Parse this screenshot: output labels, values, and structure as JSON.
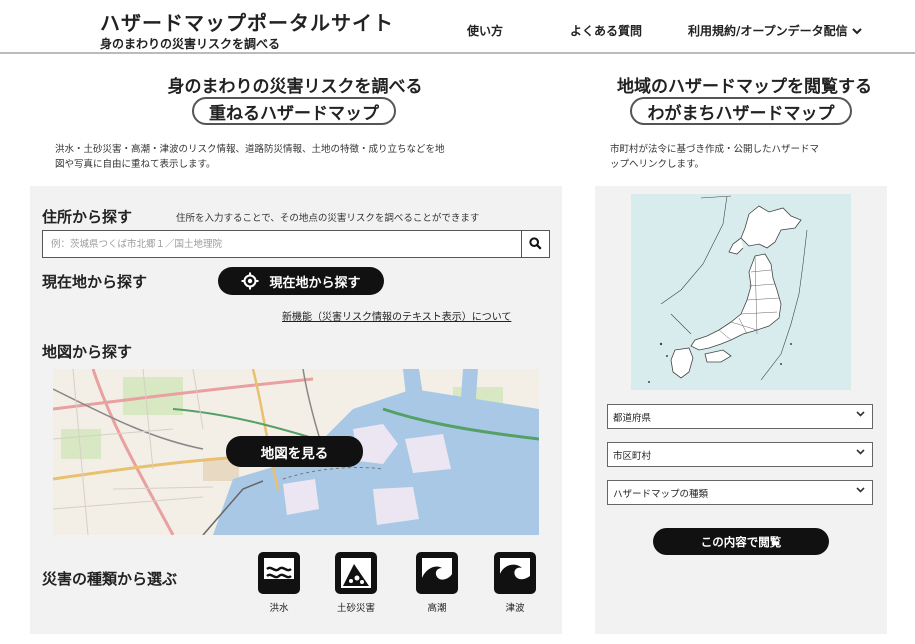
{
  "header": {
    "title": "ハザードマップポータルサイト",
    "subtitle": "身のまわりの災害リスクを調べる",
    "nav": [
      {
        "label": "使い方"
      },
      {
        "label": "よくある質問"
      },
      {
        "label": "利用規約/オープンデータ配信"
      }
    ]
  },
  "left": {
    "heading": "身のまわりの災害リスクを調べる",
    "pill": "重ねるハザードマップ",
    "intro_line1": "洪水・土砂災害・高潮・津波のリスク情報、道路防災情報、土地の特徴・成り立ちなどを地",
    "intro_line2": "図や写真に自由に重ねて表示します。",
    "address": {
      "title": "住所から探す",
      "note": "住所を入力することで、その地点の災害リスクを調べることができます",
      "placeholder": "例：茨城県つくば市北郷１／国土地理院"
    },
    "current": {
      "title": "現在地から探す",
      "button": "現在地から探す"
    },
    "new_link": "新機能（災害リスク情報のテキスト表示）について",
    "map": {
      "title": "地図から探す",
      "button": "地図を見る"
    },
    "hazard": {
      "title": "災害の種類から選ぶ",
      "items": [
        {
          "label": "洪水",
          "icon": "flood-icon"
        },
        {
          "label": "土砂災害",
          "icon": "landslide-icon"
        },
        {
          "label": "高潮",
          "icon": "storm-surge-icon"
        },
        {
          "label": "津波",
          "icon": "tsunami-icon"
        }
      ]
    }
  },
  "right": {
    "heading": "地域のハザードマップを閲覧する",
    "pill": "わがまちハザードマップ",
    "intro_line1": "市町村が法令に基づき作成・公開したハザードマ",
    "intro_line2": "ップへリンクします。",
    "selects": [
      {
        "value": "都道府県"
      },
      {
        "value": "市区町村"
      },
      {
        "value": "ハザードマップの種類"
      }
    ],
    "button": "この内容で閲覧"
  },
  "colors": {
    "accent": "#111111",
    "panel": "#f2f2f2",
    "map_water": "#a9c8e6",
    "japan_sea": "#d8ecee"
  }
}
